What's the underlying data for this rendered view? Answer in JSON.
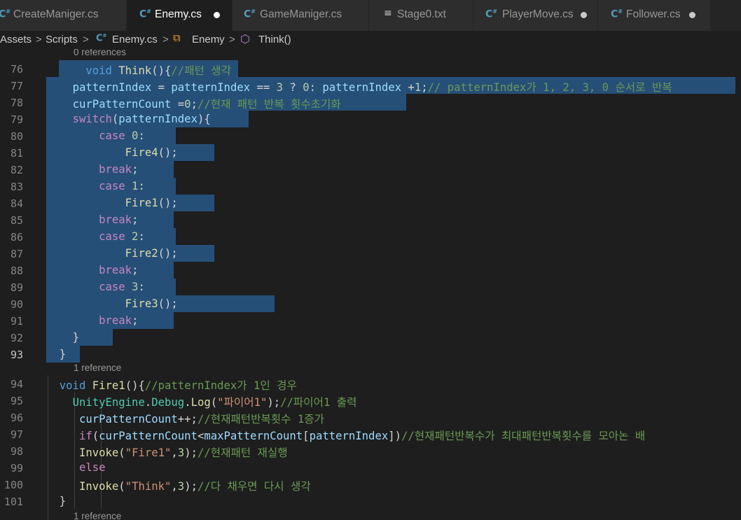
{
  "tabs": [
    {
      "label": "CreateManiger.cs",
      "icon": "csharp-icon",
      "active": false,
      "modified": false
    },
    {
      "label": "Enemy.cs",
      "icon": "csharp-icon",
      "active": true,
      "modified": true
    },
    {
      "label": "GameManiger.cs",
      "icon": "csharp-icon",
      "active": false,
      "modified": false
    },
    {
      "label": "Stage0.txt",
      "icon": "text-file-icon",
      "active": false,
      "modified": false
    },
    {
      "label": "PlayerMove.cs",
      "icon": "csharp-icon",
      "active": false,
      "modified": true
    },
    {
      "label": "Follower.cs",
      "icon": "csharp-icon",
      "active": false,
      "modified": true
    }
  ],
  "breadcrumb": {
    "items": [
      "Assets",
      "Scripts",
      "Enemy.cs",
      "Enemy",
      "Think()"
    ],
    "separator": ">"
  },
  "editor": {
    "codelens": [
      "0 references",
      "1 reference",
      "1 reference"
    ],
    "line_numbers": [
      "76",
      "77",
      "78",
      "79",
      "80",
      "81",
      "82",
      "83",
      "84",
      "85",
      "86",
      "87",
      "88",
      "89",
      "90",
      "91",
      "92",
      "93",
      "94",
      "95",
      "96",
      "97",
      "98",
      "99",
      "100",
      "101"
    ],
    "current_line": "93",
    "lines": {
      "l76": {
        "kw": "void",
        "fn": "Think",
        "punct": "(){",
        "cmt": "//패턴 생각"
      },
      "l77": {
        "v1": "patternIndex",
        "op1": " = ",
        "v2": "patternIndex",
        "op2": " == ",
        "n1": "3",
        "op3": " ? ",
        "n2": "0",
        "op4": ": ",
        "v3": "patternIndex",
        "op5": " +",
        "n3": "1",
        "semi": ";",
        "cmt": "// patternIndex가 1, 2, 3, 0 순서로 반복"
      },
      "l78": {
        "v1": "curPatternCount",
        "op": " =",
        "n": "0",
        "semi": ";",
        "cmt": "//현재 패턴 반복 횟수초기화"
      },
      "l79": {
        "kw": "switch",
        "p1": "(",
        "v": "patternIndex",
        "p2": "){"
      },
      "l80": {
        "kw": "case",
        "n": " 0",
        "p": ":"
      },
      "l81": {
        "fn": "Fire4",
        "p": "();"
      },
      "l82": {
        "kw": "break",
        "p": ";"
      },
      "l83": {
        "kw": "case",
        "n": " 1",
        "p": ":"
      },
      "l84": {
        "fn": "Fire1",
        "p": "();"
      },
      "l85": {
        "kw": "break",
        "p": ";"
      },
      "l86": {
        "kw": "case",
        "n": " 2",
        "p": ":"
      },
      "l87": {
        "fn": "Fire2",
        "p": "();"
      },
      "l88": {
        "kw": "break",
        "p": ";"
      },
      "l89": {
        "kw": "case",
        "n": " 3",
        "p": ":"
      },
      "l90": {
        "fn": "Fire3",
        "p": "();"
      },
      "l91": {
        "kw": "break",
        "p": ";"
      },
      "l92": {
        "p": "}"
      },
      "l93": {
        "p": "}"
      },
      "l94": {
        "kw": "void",
        "fn": "Fire1",
        "p": "(){",
        "cmt": "//patternIndex가 1인 경우"
      },
      "l95": {
        "cls": "UnityEngine",
        "d1": ".",
        "cls2": "Debug",
        "d2": ".",
        "fn": "Log",
        "p1": "(",
        "str": "\"파이어1\"",
        "p2": ");",
        "cmt": "//파이어1 출력"
      },
      "l96": {
        "v": "curPatternCount",
        "p": "++;",
        "cmt": "//현재패턴반복횟수 1증가"
      },
      "l97": {
        "kw": "if",
        "p1": "(",
        "v1": "curPatternCount",
        "op": "<",
        "v2": "maxPatternCount",
        "p2": "[",
        "v3": "patternIndex",
        "p3": "])",
        "cmt": "//현재패턴반복수가 최대패턴반복횟수를 모아논 배"
      },
      "l98": {
        "fn": "Invoke",
        "p1": "(",
        "str": "\"Fire1\"",
        "p2": ",",
        "n": "3",
        "p3": ");",
        "cmt": "//현재패턴 재실행"
      },
      "l99": {
        "kw": "else"
      },
      "l100": {
        "fn": "Invoke",
        "p1": "(",
        "str": "\"Think\"",
        "p2": ",",
        "n": "3",
        "p3": ");",
        "cmt": "//다 채우면 다시 생각"
      },
      "l101": {
        "p": "}"
      }
    }
  },
  "colors": {
    "background": "#1e1e1e",
    "selection": "#264f78",
    "keyword": "#569cd6",
    "control": "#c586c0",
    "function": "#dcdcaa",
    "variable": "#9cdcfe",
    "number": "#b5cea8",
    "string": "#ce9178",
    "comment": "#6a9955",
    "type": "#4ec9b0"
  }
}
